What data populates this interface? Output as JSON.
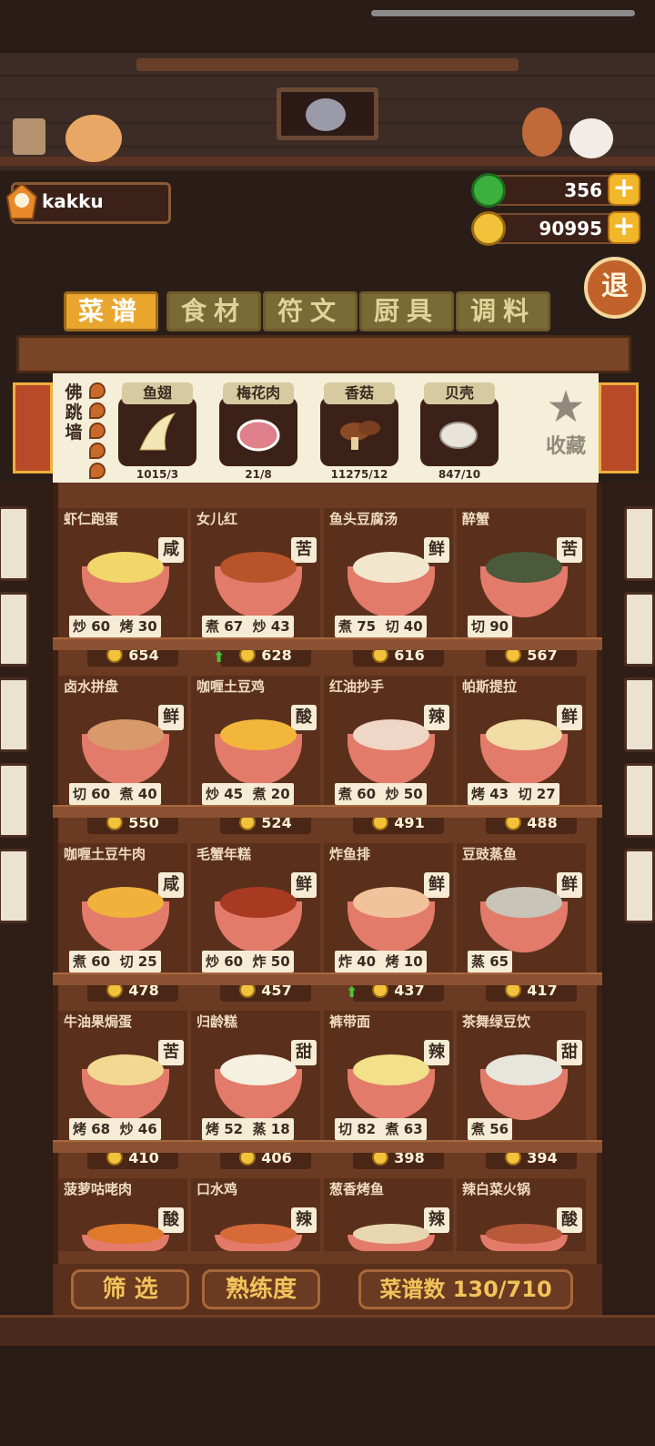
{
  "player": {
    "name": "kakku"
  },
  "currency": {
    "gems": "356",
    "coins": "90995"
  },
  "exit_label": "退",
  "tabs": [
    {
      "label": "菜谱",
      "active": true
    },
    {
      "label": "食材",
      "active": false
    },
    {
      "label": "符文",
      "active": false
    },
    {
      "label": "厨具",
      "active": false
    },
    {
      "label": "调料",
      "active": false
    }
  ],
  "featured": {
    "dish": "佛跳墙",
    "ingredients": [
      {
        "name": "鱼翅",
        "count": "1015/3"
      },
      {
        "name": "梅花肉",
        "count": "21/8"
      },
      {
        "name": "香菇",
        "count": "11275/12"
      },
      {
        "name": "贝壳",
        "count": "847/10"
      }
    ],
    "favorite_label": "收藏"
  },
  "recipes": [
    {
      "name": "虾仁跑蛋",
      "taste": "咸",
      "skills": [
        "炒 60",
        "烤 30"
      ],
      "price": "654",
      "up": false
    },
    {
      "name": "女儿红",
      "taste": "苦",
      "skills": [
        "煮 67",
        "炒 43"
      ],
      "price": "628",
      "up": true
    },
    {
      "name": "鱼头豆腐汤",
      "taste": "鲜",
      "skills": [
        "煮 75",
        "切 40"
      ],
      "price": "616",
      "up": false
    },
    {
      "name": "醉蟹",
      "taste": "苦",
      "skills": [
        "切 90"
      ],
      "price": "567",
      "up": false
    },
    {
      "name": "卤水拼盘",
      "taste": "鲜",
      "skills": [
        "切 60",
        "煮 40"
      ],
      "price": "550",
      "up": false
    },
    {
      "name": "咖喱土豆鸡",
      "taste": "酸",
      "skills": [
        "炒 45",
        "煮 20"
      ],
      "price": "524",
      "up": false
    },
    {
      "name": "红油抄手",
      "taste": "辣",
      "skills": [
        "煮 60",
        "炒 50"
      ],
      "price": "491",
      "up": false
    },
    {
      "name": "帕斯提拉",
      "taste": "鲜",
      "skills": [
        "烤 43",
        "切 27"
      ],
      "price": "488",
      "up": false
    },
    {
      "name": "咖喱土豆牛肉",
      "taste": "咸",
      "skills": [
        "煮 60",
        "切 25"
      ],
      "price": "478",
      "up": false
    },
    {
      "name": "毛蟹年糕",
      "taste": "鲜",
      "skills": [
        "炒 60",
        "炸 50"
      ],
      "price": "457",
      "up": false
    },
    {
      "name": "炸鱼排",
      "taste": "鲜",
      "skills": [
        "炸 40",
        "烤 10"
      ],
      "price": "437",
      "up": true
    },
    {
      "name": "豆豉蒸鱼",
      "taste": "鲜",
      "skills": [
        "蒸 65"
      ],
      "price": "417",
      "up": false
    },
    {
      "name": "牛油果焗蛋",
      "taste": "苦",
      "skills": [
        "烤 68",
        "炒 46"
      ],
      "price": "410",
      "up": false
    },
    {
      "name": "归龄糕",
      "taste": "甜",
      "skills": [
        "烤 52",
        "蒸 18"
      ],
      "price": "406",
      "up": false
    },
    {
      "name": "裤带面",
      "taste": "辣",
      "skills": [
        "切 82",
        "煮 63"
      ],
      "price": "398",
      "up": false
    },
    {
      "name": "茶舞绿豆饮",
      "taste": "甜",
      "skills": [
        "煮 56"
      ],
      "price": "394",
      "up": false
    },
    {
      "name": "菠萝咕咾肉",
      "taste": "酸",
      "skills": [],
      "price": "",
      "up": false
    },
    {
      "name": "口水鸡",
      "taste": "辣",
      "skills": [],
      "price": "",
      "up": false
    },
    {
      "name": "葱香烤鱼",
      "taste": "辣",
      "skills": [],
      "price": "",
      "up": false
    },
    {
      "name": "辣白菜火锅",
      "taste": "酸",
      "skills": [],
      "price": "",
      "up": false
    }
  ],
  "bottom": {
    "filter": "筛 选",
    "mastery": "熟练度",
    "recipe_count": "菜谱数 130/710"
  },
  "colors": {
    "tab_active": "#e9a62e",
    "tab_inactive": "#7a6a35",
    "gold": "#f2c33a",
    "wood": "#6a3a22"
  }
}
